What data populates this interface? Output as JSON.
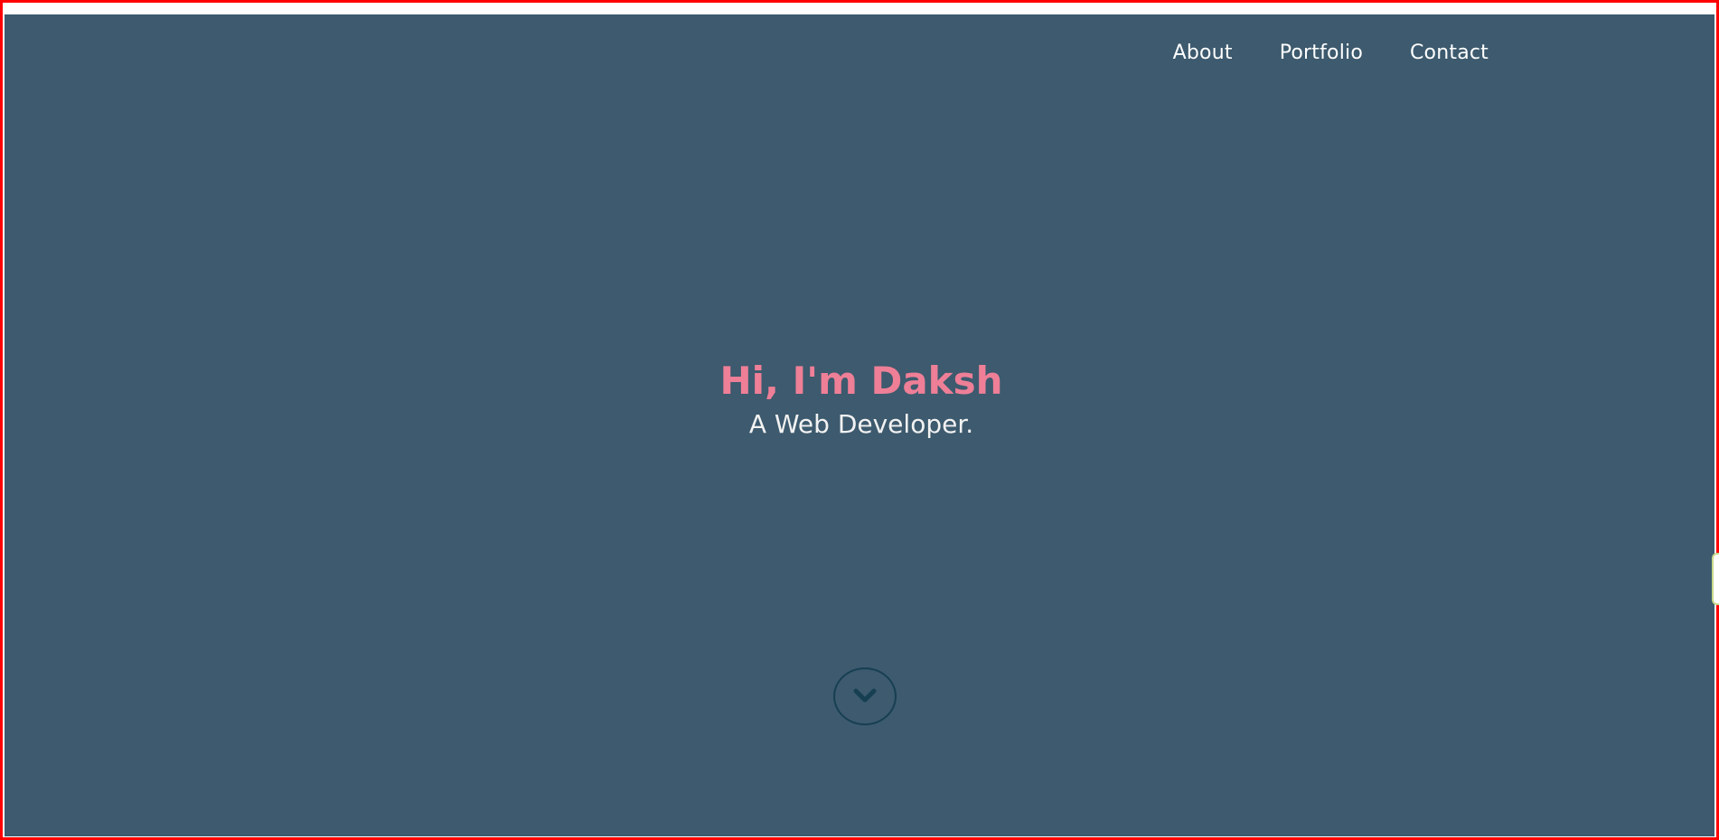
{
  "nav": {
    "items": [
      {
        "label": "About"
      },
      {
        "label": "Portfolio"
      },
      {
        "label": "Contact"
      }
    ]
  },
  "hero": {
    "title": "Hi, I'm Daksh",
    "subtitle": "A Web Developer."
  },
  "icons": {
    "scroll_down": "chevron-down-icon"
  },
  "colors": {
    "hero_background": "#3d5a6e",
    "title": "#ee7f97",
    "subtitle": "#f2f2f2",
    "nav_text": "#ffffff",
    "scroll_button": "#173f52",
    "frame_border": "#ff0000"
  }
}
